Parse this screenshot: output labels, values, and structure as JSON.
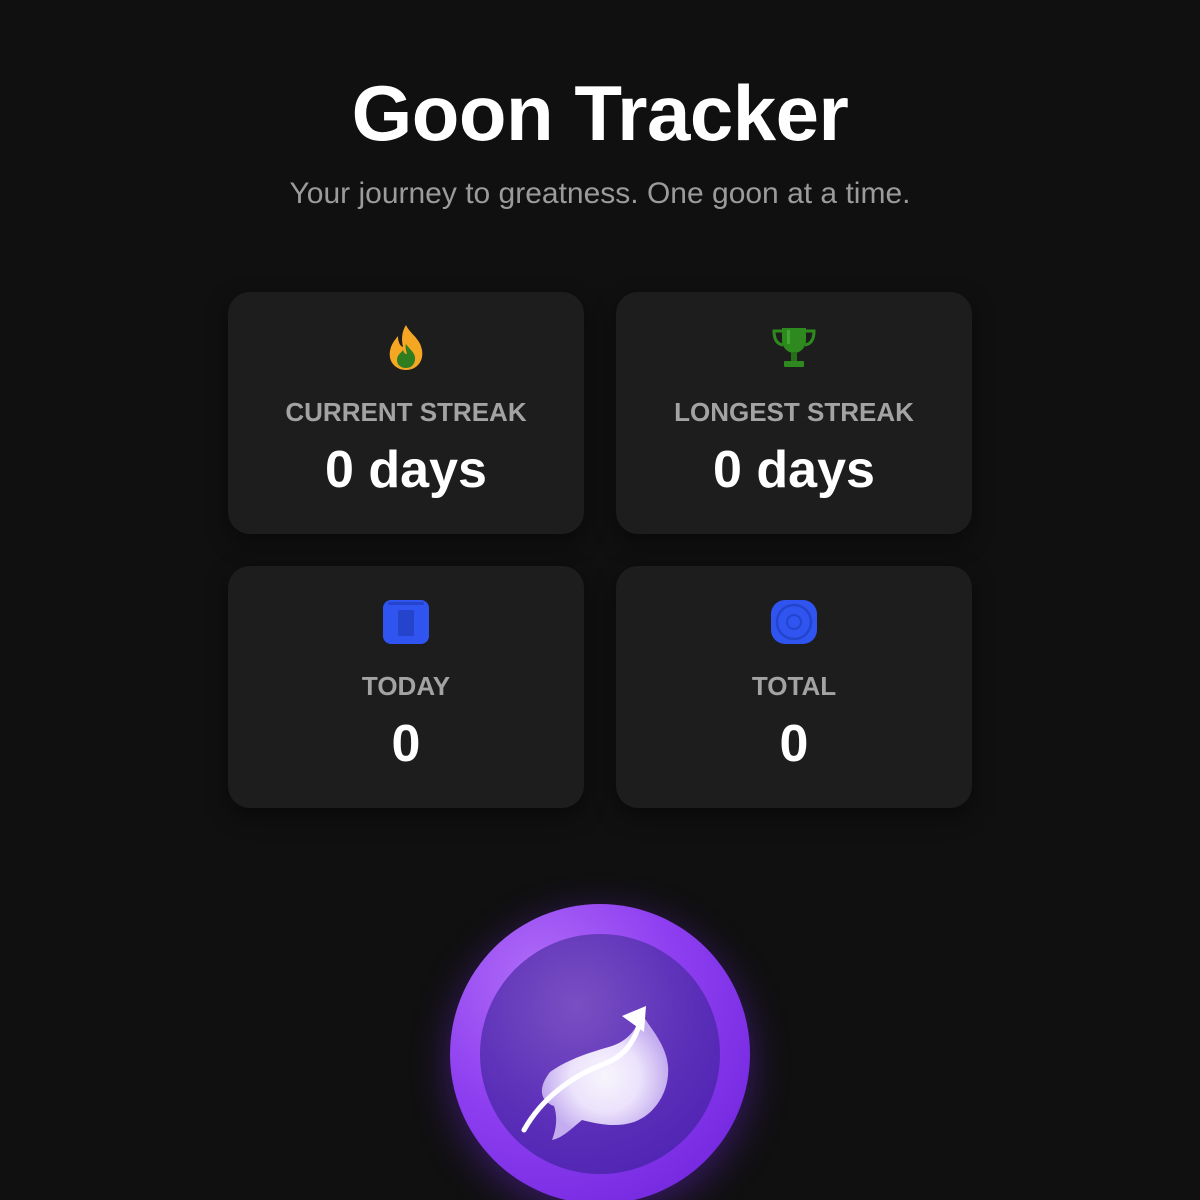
{
  "header": {
    "title": "Goon Tracker",
    "subtitle": "Your journey to greatness. One goon at a time."
  },
  "stats": [
    {
      "icon": "fire-icon",
      "label": "CURRENT STREAK",
      "value": "0 days"
    },
    {
      "icon": "trophy-icon",
      "label": "LONGEST STREAK",
      "value": "0 days"
    },
    {
      "icon": "calendar-icon",
      "label": "TODAY",
      "value": "0"
    },
    {
      "icon": "target-icon",
      "label": "TOTAL",
      "value": "0"
    }
  ],
  "colors": {
    "background": "#101010",
    "card": "#1d1d1d",
    "label": "#a3a3a3",
    "subtitle": "#9b9b9b",
    "accent": "#8d3ef0",
    "icon_blue": "#2f54f0",
    "fire_orange": "#f5a623",
    "fire_green": "#2e7d1f",
    "trophy_green": "#2e8a1e"
  },
  "action_button": {
    "icon": "goon-arrow-icon"
  }
}
